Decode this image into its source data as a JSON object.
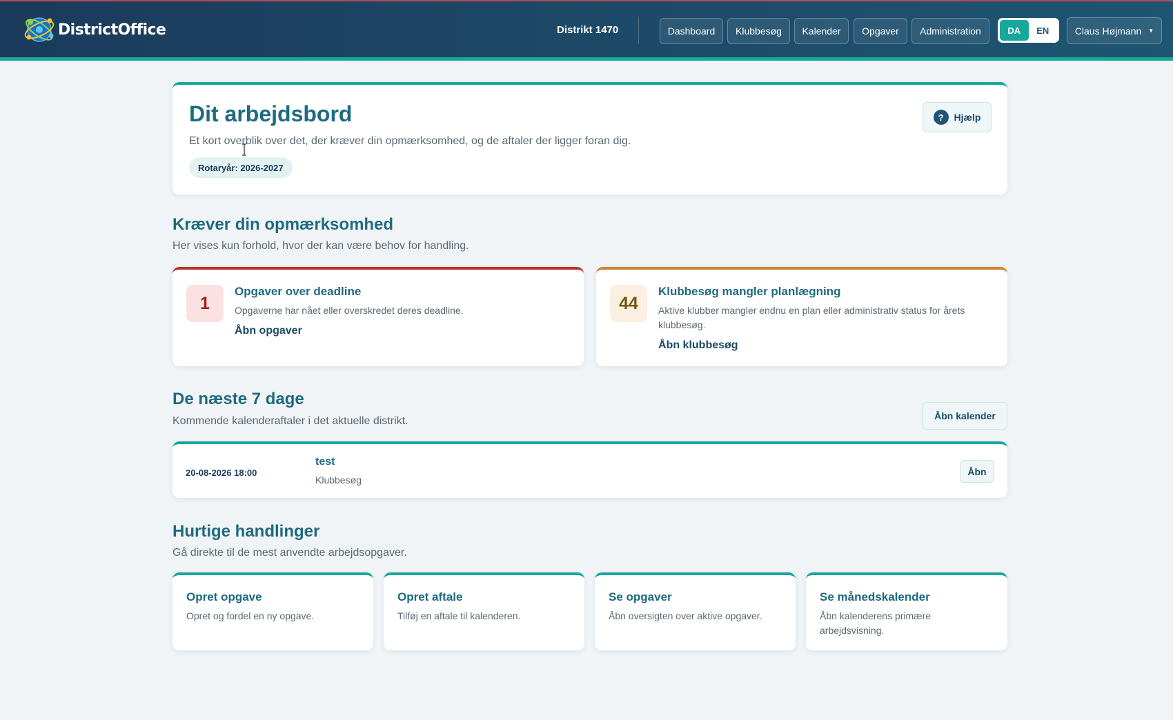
{
  "header": {
    "app_name": "DistrictOffice",
    "district": "Distrikt 1470",
    "nav": [
      "Dashboard",
      "Klubbesøg",
      "Kalender",
      "Opgaver",
      "Administration"
    ],
    "languages": {
      "active": "DA",
      "other": "EN"
    },
    "user": "Claus Højmann"
  },
  "hero": {
    "title": "Dit arbejdsbord",
    "subtitle": "Et kort overblik over det, der kræver din opmærksomhed, og de aftaler der ligger foran dig.",
    "rotary_year": "Rotaryår: 2026-2027",
    "help_label": "Hjælp"
  },
  "attention": {
    "title": "Kræver din opmærksomhed",
    "subtitle": "Her vises kun forhold, hvor der kan være behov for handling.",
    "cards": [
      {
        "count": "1",
        "title": "Opgaver over deadline",
        "description": "Opgaverne har nået eller overskredet deres deadline.",
        "link": "Åbn opgaver"
      },
      {
        "count": "44",
        "title": "Klubbesøg mangler planlægning",
        "description": "Aktive klubber mangler endnu en plan eller administrativ status for årets klubbesøg.",
        "link": "Åbn klubbesøg"
      }
    ]
  },
  "upcoming": {
    "title": "De næste 7 dage",
    "subtitle": "Kommende kalenderaftaler i det aktuelle distrikt.",
    "open_calendar": "Åbn kalender",
    "events": [
      {
        "datetime": "20-08-2026 18:00",
        "title": "test",
        "type": "Klubbesøg",
        "open": "Åbn"
      }
    ]
  },
  "quick": {
    "title": "Hurtige handlinger",
    "subtitle": "Gå direkte til de mest anvendte arbejdsopgaver.",
    "actions": [
      {
        "title": "Opret opgave",
        "description": "Opret og fordel en ny opgave."
      },
      {
        "title": "Opret aftale",
        "description": "Tilføj en aftale til kalenderen."
      },
      {
        "title": "Se opgaver",
        "description": "Åbn oversigten over aktive opgaver."
      },
      {
        "title": "Se månedskalender",
        "description": "Åbn kalenderens primære arbejdsvisning."
      }
    ]
  },
  "colors": {
    "header_bg": "#1b3a5c",
    "accent_teal": "#17a89b",
    "heading": "#1e6a80",
    "alert_red": "#b8322f",
    "alert_orange": "#d0822f"
  }
}
